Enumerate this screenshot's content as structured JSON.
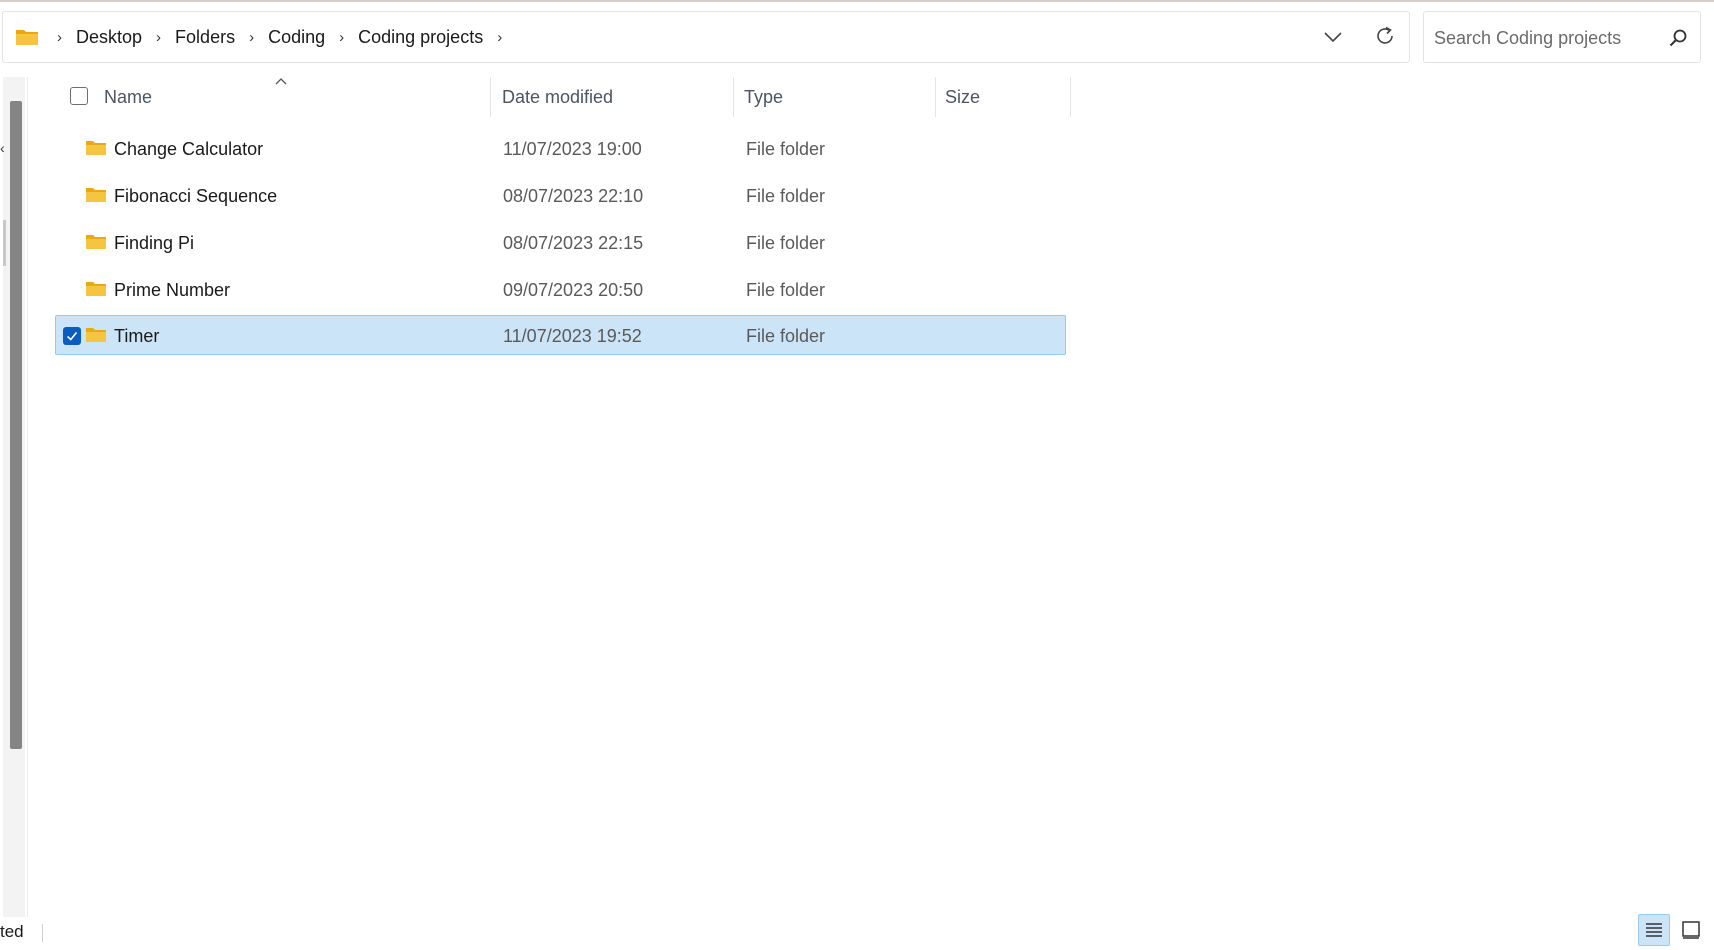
{
  "breadcrumb": {
    "items": [
      "Desktop",
      "Folders",
      "Coding",
      "Coding projects"
    ]
  },
  "search": {
    "placeholder": "Search Coding projects"
  },
  "columns": {
    "name": "Name",
    "date_modified": "Date modified",
    "type": "Type",
    "size": "Size"
  },
  "files": [
    {
      "name": "Change Calculator",
      "date": "11/07/2023 19:00",
      "type": "File folder",
      "selected": false
    },
    {
      "name": "Fibonacci Sequence",
      "date": "08/07/2023 22:10",
      "type": "File folder",
      "selected": false
    },
    {
      "name": "Finding Pi",
      "date": "08/07/2023 22:15",
      "type": "File folder",
      "selected": false
    },
    {
      "name": "Prime Number",
      "date": "09/07/2023 20:50",
      "type": "File folder",
      "selected": false
    },
    {
      "name": "Timer",
      "date": "11/07/2023 19:52",
      "type": "File folder",
      "selected": true
    }
  ],
  "status": {
    "text": "ted"
  },
  "colors": {
    "folder": "#f5c542",
    "folder_dark": "#e8a912",
    "selection": "#cce4f7",
    "selection_border": "#99c9ef",
    "check_accent": "#0a5cbf"
  },
  "icons": {
    "address_folder": "folder-icon",
    "dropdown": "chevron-down-icon",
    "refresh": "refresh-icon",
    "search": "search-icon",
    "sort": "sort-ascending-icon",
    "view_details": "details-view-icon",
    "view_tiles": "large-icons-view-icon"
  }
}
